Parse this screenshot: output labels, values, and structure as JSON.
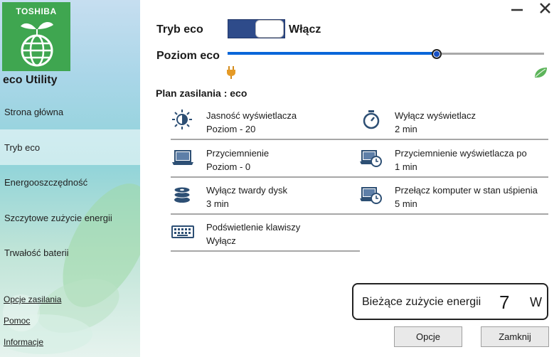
{
  "window": {
    "minimize_icon": "minimize-icon",
    "close_icon": "close-icon"
  },
  "sidebar": {
    "brand": "TOSHIBA",
    "app_title": "eco Utility",
    "items": [
      {
        "label": "Strona główna"
      },
      {
        "label": "Tryb eco"
      },
      {
        "label": "Energooszczędność"
      },
      {
        "label": "Szczytowe zużycie energii"
      },
      {
        "label": "Trwałość baterii"
      }
    ],
    "active_index": 1,
    "links": [
      {
        "label": "Opcje zasilania"
      },
      {
        "label": "Pomoc"
      },
      {
        "label": "Informacje"
      }
    ]
  },
  "eco_mode": {
    "label": "Tryb eco",
    "state": "Włącz",
    "enabled": true
  },
  "eco_level": {
    "label": "Poziom eco",
    "value_fraction": 0.66,
    "min_icon": "plug-icon",
    "max_icon": "leaf-icon"
  },
  "plan": {
    "heading": "Plan zasilania : eco",
    "settings": [
      {
        "name": "Jasność wyświetlacza",
        "value": "Poziom - 20",
        "icon": "brightness-icon"
      },
      {
        "name": "Wyłącz wyświetlacz",
        "value": "2 min",
        "icon": "timer-icon"
      },
      {
        "name": "Przyciemnienie",
        "value": "Poziom - 0",
        "icon": "laptop-icon"
      },
      {
        "name": "Przyciemnienie wyświetlacza po",
        "value": "1 min",
        "icon": "laptop-clock-icon"
      },
      {
        "name": "Wyłącz twardy dysk",
        "value": "3 min",
        "icon": "hard-disk-icon"
      },
      {
        "name": "Przełącz komputer w stan uśpienia",
        "value": "5 min",
        "icon": "sleep-clock-icon"
      },
      {
        "name": "Podświetlenie klawiszy",
        "value": "Wyłącz",
        "icon": "keyboard-icon"
      }
    ]
  },
  "power": {
    "label": "Bieżące zużycie energii",
    "value": "7",
    "unit": "W"
  },
  "buttons": {
    "options": "Opcje",
    "close": "Zamknij"
  },
  "colors": {
    "accent": "#2e4b8a",
    "slider_fill": "#0a66d9",
    "logo_green": "#3fa650"
  }
}
